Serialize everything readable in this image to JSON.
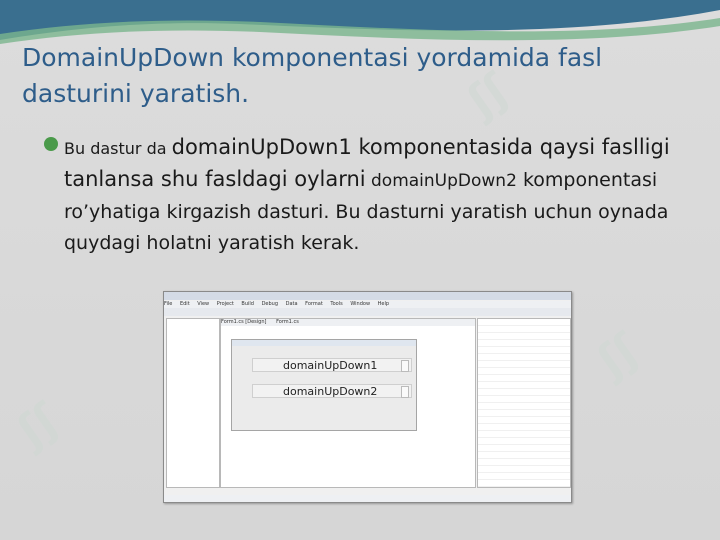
{
  "title": "DomainUpDown komponentasi yordamida fasl dasturini yaratish.",
  "paragraph": {
    "part1": "Bu dastur da ",
    "part2": "domainUpDown1 komponentasida qaysi faslligi tanlansa shu fasldagi oylarni",
    "part3": " domainUpDown2",
    "part4": "komponentasi ro’yhatiga kirgazish dasturi. Bu dasturni yaratish uchun oynada quydagi holatni yaratish kerak."
  },
  "screenshot": {
    "tabs": [
      "Form1.cs [Design]",
      "Form1.cs"
    ],
    "updown1": "domainUpDown1",
    "updown2": "domainUpDown2",
    "menu": [
      "File",
      "Edit",
      "View",
      "Project",
      "Build",
      "Debug",
      "Data",
      "Format",
      "Tools",
      "Window",
      "Help"
    ]
  },
  "colors": {
    "title": "#2e5d8a",
    "bullet": "#4a9a4a",
    "watermark": "#cfd8d3"
  }
}
